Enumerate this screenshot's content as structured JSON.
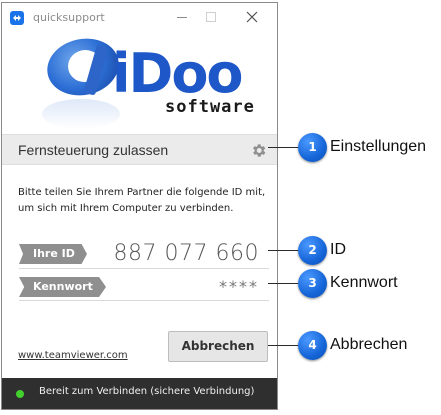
{
  "window": {
    "title": "quicksupport",
    "app_icon": "teamviewer-icon",
    "controls": {
      "minimize": "minimize-icon",
      "maximize": "maximize-icon",
      "close": "close-icon"
    }
  },
  "logo": {
    "brand": "iDoo",
    "sub": "software"
  },
  "allow_section": {
    "title": "Fernsteuerung zulassen",
    "settings_icon": "gear-icon"
  },
  "description": "Bitte teilen Sie Ihrem Partner die folgende ID mit, um sich mit Ihrem Computer zu verbinden.",
  "fields": {
    "id_label": "Ihre ID",
    "id_value": "887 077 660",
    "password_label": "Kennwort",
    "password_value": "****"
  },
  "footer": {
    "link": "www.teamviewer.com",
    "cancel_label": "Abbrechen"
  },
  "status": {
    "text": "Bereit zum Verbinden (sichere Verbindung)",
    "indicator_color": "#43d12f"
  },
  "callouts": [
    {
      "number": "1",
      "label": "Einstellungen"
    },
    {
      "number": "2",
      "label": "ID"
    },
    {
      "number": "3",
      "label": "Kennwort"
    },
    {
      "number": "4",
      "label": "Abbrechen"
    }
  ]
}
